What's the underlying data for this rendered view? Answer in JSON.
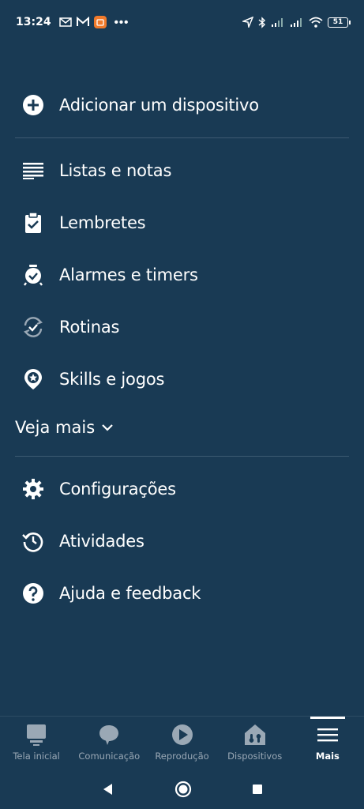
{
  "status_bar": {
    "time": "13:24",
    "dots": "•••",
    "battery": "51",
    "left_icons": [
      "mail-x-icon",
      "gmail-icon",
      "app-notification-icon"
    ],
    "right_icons": [
      "location-icon",
      "bluetooth-icon",
      "signal-icon",
      "signal-icon",
      "wifi-icon",
      "battery-icon"
    ]
  },
  "menu": {
    "add_device": "Adicionar um dispositivo",
    "items": [
      {
        "label": "Listas e notas",
        "icon": "list-icon"
      },
      {
        "label": "Lembretes",
        "icon": "clipboard-check-icon"
      },
      {
        "label": "Alarmes e timers",
        "icon": "alarm-icon"
      },
      {
        "label": "Rotinas",
        "icon": "routines-icon"
      },
      {
        "label": "Skills e jogos",
        "icon": "skills-icon"
      }
    ],
    "see_more": "Veja mais",
    "settings": [
      {
        "label": "Configurações",
        "icon": "gear-icon"
      },
      {
        "label": "Atividades",
        "icon": "history-icon"
      },
      {
        "label": "Ajuda e feedback",
        "icon": "help-icon"
      }
    ]
  },
  "bottom_nav": [
    {
      "label": "Tela inicial",
      "icon": "home-icon"
    },
    {
      "label": "Comunicação",
      "icon": "chat-icon"
    },
    {
      "label": "Reprodução",
      "icon": "play-icon"
    },
    {
      "label": "Dispositivos",
      "icon": "devices-icon"
    },
    {
      "label": "Mais",
      "icon": "menu-icon",
      "active": true
    }
  ],
  "colors": {
    "background": "#193a54",
    "text": "#ffffff",
    "inactive_nav": "#9aa8b5",
    "divider": "#3d5a72"
  }
}
